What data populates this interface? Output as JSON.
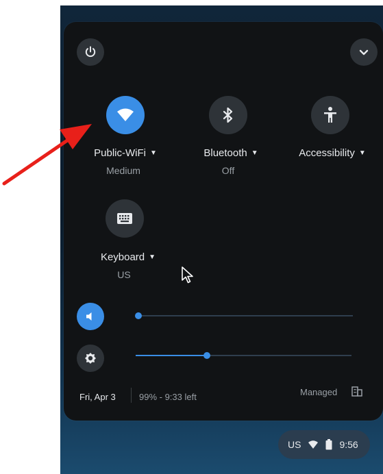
{
  "colors": {
    "accent": "#3a8ee6",
    "panel": "#111315",
    "button": "#2e3338",
    "annotation": "#e8201a"
  },
  "header": {
    "power_icon": "power-icon",
    "collapse_icon": "chevron-down-icon"
  },
  "tiles": [
    {
      "label": "Public-WiFi",
      "sublabel": "Medium",
      "icon": "wifi-icon",
      "active": true
    },
    {
      "label": "Bluetooth",
      "sublabel": "Off",
      "icon": "bluetooth-icon",
      "active": false
    },
    {
      "label": "Accessibility",
      "sublabel": "",
      "icon": "accessibility-icon",
      "active": false
    },
    {
      "label": "Keyboard",
      "sublabel": "US",
      "icon": "keyboard-icon",
      "active": false
    }
  ],
  "sliders": {
    "volume": {
      "icon": "volume-icon",
      "level": 0.0
    },
    "brightness": {
      "icon": "brightness-icon",
      "level": 0.33
    }
  },
  "footer": {
    "date": "Fri, Apr 3",
    "battery": "99% - 9:33 left",
    "managed": "Managed"
  },
  "shelf": {
    "ime": "US",
    "time": "9:56"
  }
}
